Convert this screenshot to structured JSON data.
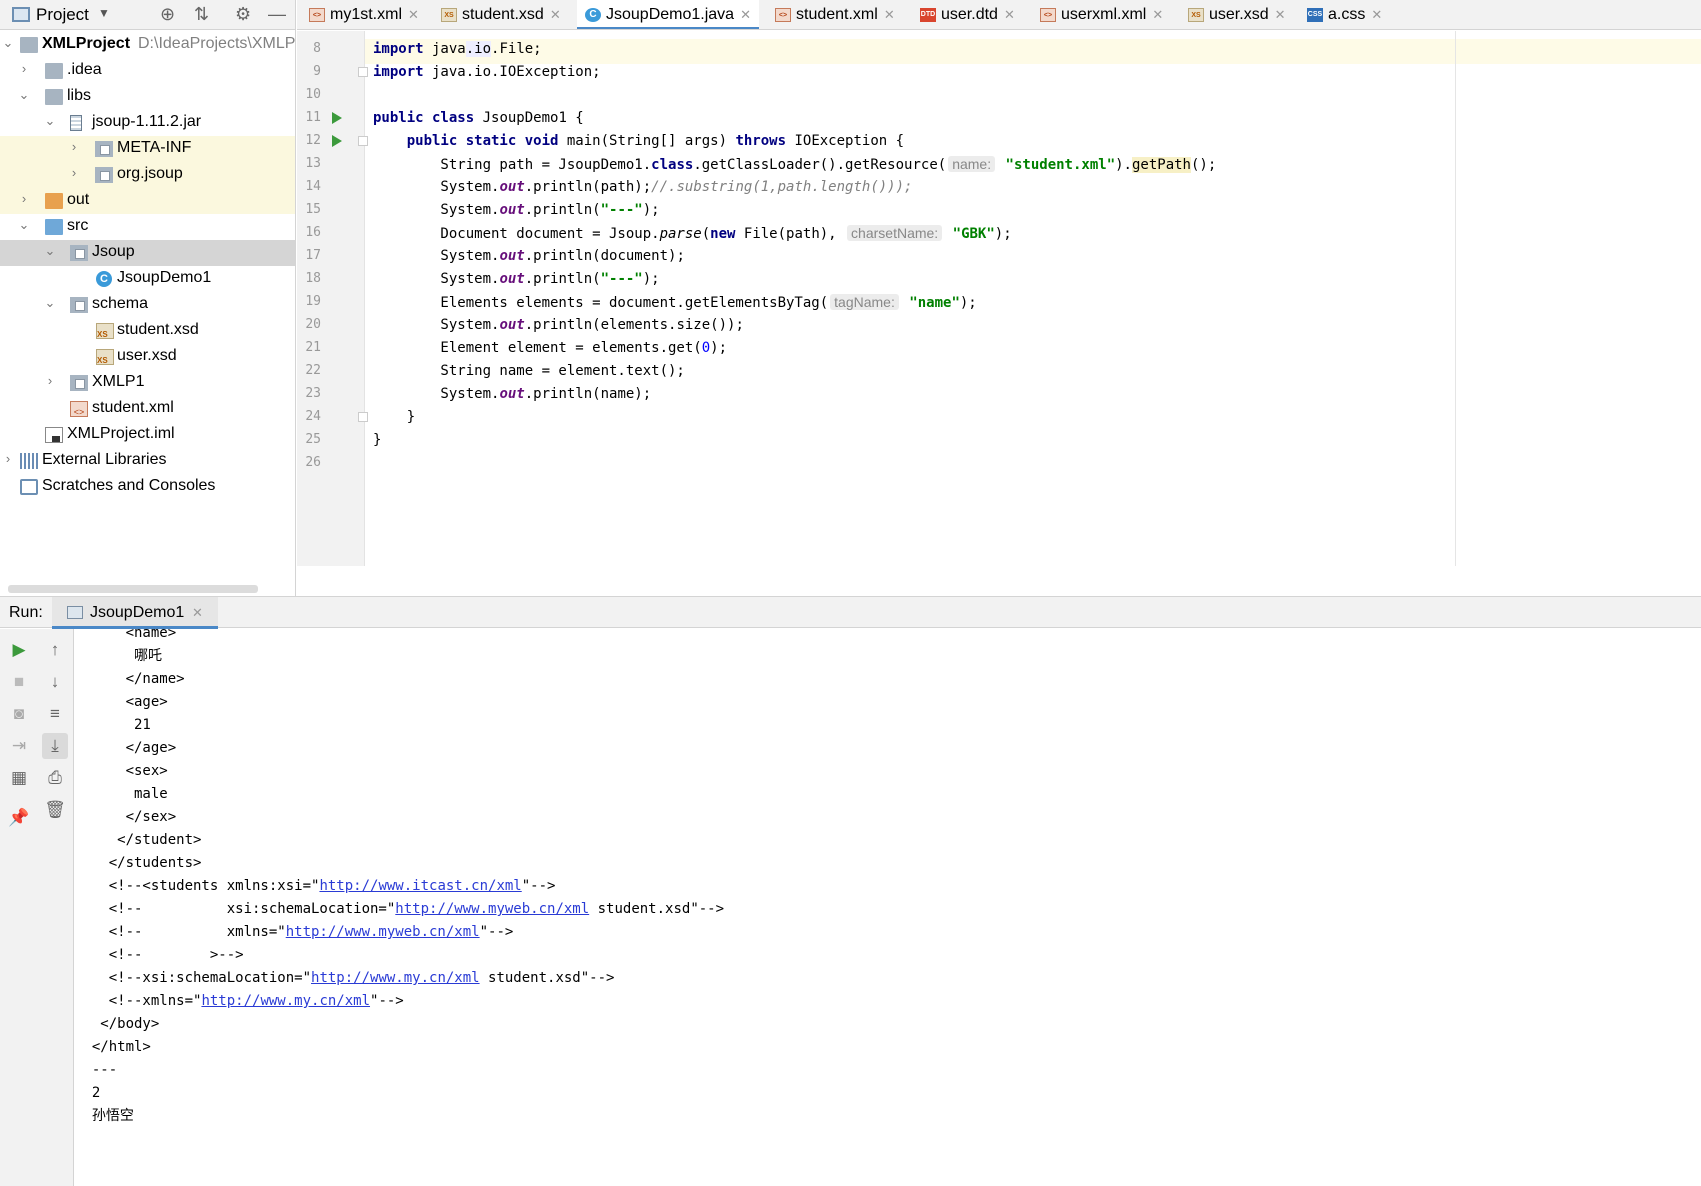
{
  "project_panel": {
    "title": "Project",
    "tree": [
      {
        "label": "XMLProject",
        "path": "D:\\IdeaProjects\\XMLP",
        "icon": "project-module-icon"
      },
      {
        "label": ".idea",
        "icon": "folder-icon"
      },
      {
        "label": "libs",
        "icon": "folder-icon"
      },
      {
        "label": "jsoup-1.11.2.jar",
        "icon": "jar-icon"
      },
      {
        "label": "META-INF",
        "icon": "package-icon"
      },
      {
        "label": "org.jsoup",
        "icon": "package-icon"
      },
      {
        "label": "out",
        "icon": "folder-icon"
      },
      {
        "label": "src",
        "icon": "folder-icon"
      },
      {
        "label": "Jsoup",
        "icon": "package-icon"
      },
      {
        "label": "JsoupDemo1",
        "icon": "java-class-icon"
      },
      {
        "label": "schema",
        "icon": "package-icon"
      },
      {
        "label": "student.xsd",
        "icon": "xsd-file-icon"
      },
      {
        "label": "user.xsd",
        "icon": "xsd-file-icon"
      },
      {
        "label": "XMLP1",
        "icon": "package-icon"
      },
      {
        "label": "student.xml",
        "icon": "xml-file-icon"
      },
      {
        "label": "XMLProject.iml",
        "icon": "iml-file-icon"
      },
      {
        "label": "External Libraries",
        "icon": "library-icon"
      },
      {
        "label": "Scratches and Consoles",
        "icon": "scratch-icon"
      }
    ]
  },
  "tabs": [
    {
      "label": "my1st.xml",
      "icon": "xml-file-icon",
      "icon_text": "<>"
    },
    {
      "label": "student.xsd",
      "icon": "xsd-file-icon",
      "icon_text": "XS"
    },
    {
      "label": "JsoupDemo1.java",
      "icon": "java-class-icon",
      "icon_text": "C",
      "active": true
    },
    {
      "label": "student.xml",
      "icon": "xml-file-icon",
      "icon_text": "<>"
    },
    {
      "label": "user.dtd",
      "icon": "dtd-file-icon",
      "icon_text": "DTD"
    },
    {
      "label": "userxml.xml",
      "icon": "xml-file-icon",
      "icon_text": "<>"
    },
    {
      "label": "user.xsd",
      "icon": "xsd-file-icon",
      "icon_text": "XS"
    },
    {
      "label": "a.css",
      "icon": "css-file-icon",
      "icon_text": "CSS"
    }
  ],
  "editor": {
    "line_numbers": [
      "8",
      "9",
      "10",
      "11",
      "12",
      "13",
      "14",
      "15",
      "16",
      "17",
      "18",
      "19",
      "20",
      "21",
      "22",
      "23",
      "24",
      "25",
      "26"
    ],
    "lines": [
      "<span class=\"kw\">import</span> java<span class=\"caretbox\">.io</span>.File;",
      "<span class=\"kw\">import</span> java.io.IOException;",
      "",
      "<span class=\"kw\">public class</span> JsoupDemo1 {",
      "    <span class=\"kw\">public static void</span> main(String[] args) <span class=\"kw\">throws</span> IOException {",
      "        String path = JsoupDemo1.<span class=\"kw\">class</span>.getClassLoader().getResource(<span class=\"hint\">name:</span> <span class=\"str\">\"student.xml\"</span>).<span class=\"hlbg\">getPath</span>();",
      "        System.<span class=\"fld\">out</span>.println(path);<span class=\"cmt\">//.substring(1,path.length()));</span>",
      "        System.<span class=\"fld\">out</span>.println(<span class=\"str\">\"---\"</span>);",
      "        Document document = Jsoup.<span class=\"it\">parse</span>(<span class=\"kw\">new</span> File(path), <span class=\"hint\">charsetName:</span> <span class=\"str\">\"GBK\"</span>);",
      "        System.<span class=\"fld\">out</span>.println(document);",
      "        System.<span class=\"fld\">out</span>.println(<span class=\"str\">\"---\"</span>);",
      "        Elements elements = document.getElementsByTag(<span class=\"hint\">tagName:</span> <span class=\"str\">\"name\"</span>);",
      "        System.<span class=\"fld\">out</span>.println(elements.size());",
      "        Element element = elements.get(<span class=\"num\">0</span>);",
      "        String name = element.text();",
      "        System.<span class=\"fld\">out</span>.println(name);",
      "    }",
      "}",
      ""
    ]
  },
  "run_panel": {
    "label": "Run:",
    "tab": "JsoupDemo1",
    "output": [
      "      <name>",
      "       哪吒",
      "      </name>",
      "      <age>",
      "       21",
      "      </age>",
      "      <sex>",
      "       male",
      "      </sex>",
      "     </student>",
      "    </students>",
      "    <!--<students xmlns:xsi=\"<a class=\"link\">http://www.itcast.cn/xml</a>\"-->",
      "    <!--          xsi:schemaLocation=\"<a class=\"link\">http://www.myweb.cn/xml</a> student.xsd\"-->",
      "    <!--          xmlns=\"<a class=\"link\">http://www.myweb.cn/xml</a>\"-->",
      "    <!--        >-->",
      "    <!--xsi:schemaLocation=\"<a class=\"link\">http://www.my.cn/xml</a> student.xsd\"-->",
      "    <!--xmlns=\"<a class=\"link\">http://www.my.cn/xml</a>\"-->",
      "   </body>",
      "  </html>",
      "  ---",
      "  2",
      "  孙悟空"
    ]
  }
}
